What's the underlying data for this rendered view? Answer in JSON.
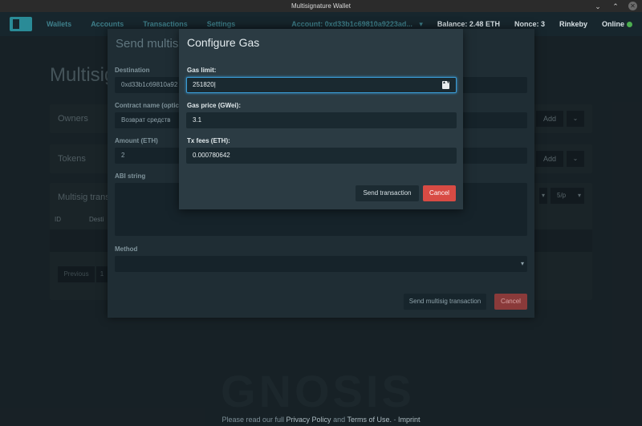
{
  "window": {
    "title": "Multisignature Wallet",
    "controls": {
      "minimize": "⌄",
      "maximize": "⌃",
      "close": "✕"
    }
  },
  "navbar": {
    "items": [
      "Wallets",
      "Accounts",
      "Transactions",
      "Settings"
    ],
    "account": "Account: 0xd33b1c69810a9223ad...",
    "account_caret": "▾",
    "balance": "Balance: 2.48 ETH",
    "nonce": "Nonce: 3",
    "network": "Rinkeby",
    "status": "Online"
  },
  "page": {
    "title": "Multisig",
    "panels": {
      "owners": "Owners",
      "tokens": "Tokens",
      "transactions": "Multisig trans",
      "add": "Add",
      "chevron": "⌄"
    },
    "table": {
      "id": "ID",
      "dest": "Desti"
    },
    "pagination": {
      "previous": "Previous",
      "page": "1"
    },
    "per_page": "5/p",
    "per_page_caret": "▾"
  },
  "send_modal": {
    "title": "Send multisi",
    "destination_label": "Destination",
    "destination_value": "0xd33b1c69810a92",
    "contract_label": "Contract name (optic",
    "contract_value": "Возврат средств",
    "amount_label": "Amount (ETH)",
    "amount_value": "2",
    "abi_label": "ABI string",
    "method_label": "Method",
    "send_btn": "Send multisig transaction",
    "cancel_btn": "Cancel"
  },
  "gas_modal": {
    "title": "Configure Gas",
    "gas_limit_label": "Gas limit:",
    "gas_limit_value": "251820",
    "stepper": "▲▼",
    "gas_price_label": "Gas price (GWei):",
    "gas_price_value": "3.1",
    "tx_fees_label": "Tx fees (ETH):",
    "tx_fees_value": "0.000780642",
    "send_btn": "Send transaction",
    "cancel_btn": "Cancel"
  },
  "footer": {
    "prefix": "Please read our full",
    "privacy": "Privacy Policy",
    "and": "and",
    "terms": "Terms of Use.",
    "dash": "-",
    "imprint": "Imprint"
  },
  "watermark": "GNOSIS"
}
